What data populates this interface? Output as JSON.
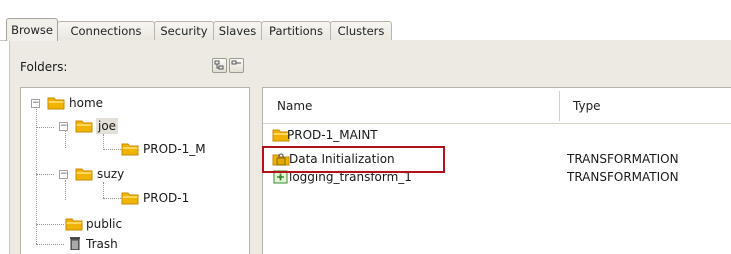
{
  "tabs": [
    {
      "label": "Browse",
      "active": true
    },
    {
      "label": "Connections",
      "active": false
    },
    {
      "label": "Security",
      "active": false
    },
    {
      "label": "Slaves",
      "active": false
    },
    {
      "label": "Partitions",
      "active": false
    },
    {
      "label": "Clusters",
      "active": false
    }
  ],
  "folders_panel": {
    "label": "Folders:",
    "toolbar_icons": [
      "expand-tree-icon",
      "collapse-tree-icon"
    ]
  },
  "tree": {
    "home": "home",
    "joe": "joe",
    "joe_child": "PROD-1_M",
    "suzy": "suzy",
    "suzy_child": "PROD-1",
    "public": "public",
    "trash": "Trash",
    "selected": "joe"
  },
  "list": {
    "columns": {
      "name": "Name",
      "type": "Type"
    },
    "rows": [
      {
        "name": "PROD-1_MAINT",
        "type": "",
        "icon": "folder-icon"
      },
      {
        "name": "Data Initialization",
        "type": "TRANSFORMATION",
        "icon": "locked-transformation-icon",
        "highlighted": true
      },
      {
        "name": "logging_transform_1",
        "type": "TRANSFORMATION",
        "icon": "transformation-icon"
      }
    ]
  },
  "colors": {
    "folder": "#f0b400",
    "folder_dark": "#c98a00",
    "highlight_border": "#b3121b",
    "panel_bg": "#eceae2",
    "transformation_icon": "#3a8a2a"
  }
}
